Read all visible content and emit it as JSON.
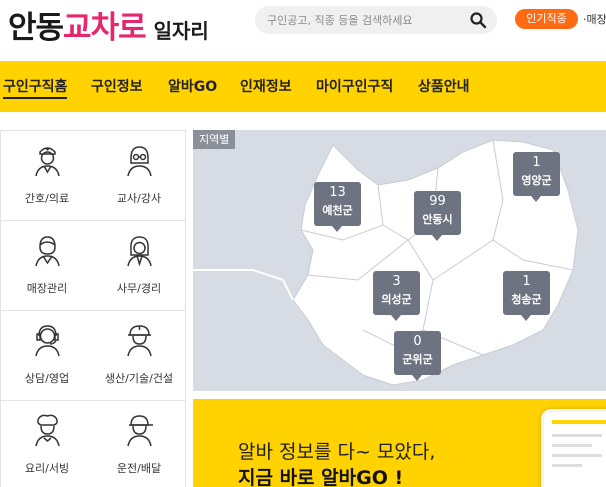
{
  "header": {
    "logo": {
      "part1": "안동",
      "part2": "교차로",
      "part3": "일자리"
    },
    "search": {
      "placeholder": "구인공고, 직종 등을 검색하세요"
    },
    "hot_badge": "인기직종",
    "hot_item": "·매장"
  },
  "nav": {
    "items": [
      "구인구직홈",
      "구인정보",
      "알바GO",
      "인재정보",
      "마이구인구직",
      "상품안내"
    ]
  },
  "categories": [
    {
      "label": "간호/의료",
      "icon": "nurse-icon"
    },
    {
      "label": "교사/강사",
      "icon": "teacher-icon"
    },
    {
      "label": "매장관리",
      "icon": "store-manager-icon"
    },
    {
      "label": "사무/경리",
      "icon": "office-worker-icon"
    },
    {
      "label": "상담/영업",
      "icon": "call-center-icon"
    },
    {
      "label": "생산/기술/건설",
      "icon": "construction-worker-icon"
    },
    {
      "label": "요리/서빙",
      "icon": "chef-icon"
    },
    {
      "label": "운전/배달",
      "icon": "delivery-driver-icon"
    }
  ],
  "map": {
    "label": "지역별",
    "regions": [
      {
        "name": "예천군",
        "count": "13"
      },
      {
        "name": "안동시",
        "count": "99"
      },
      {
        "name": "영양군",
        "count": "1"
      },
      {
        "name": "의성군",
        "count": "3"
      },
      {
        "name": "청송군",
        "count": "1"
      },
      {
        "name": "군위군",
        "count": "0"
      }
    ]
  },
  "banner": {
    "line1": "알바 정보를 다~ 모았다,",
    "line2": "지금 바로 알바GO !"
  },
  "colors": {
    "brand_yellow": "#ffd200",
    "logo_pink": "#e6266d",
    "hot_orange": "#ff6a12"
  }
}
